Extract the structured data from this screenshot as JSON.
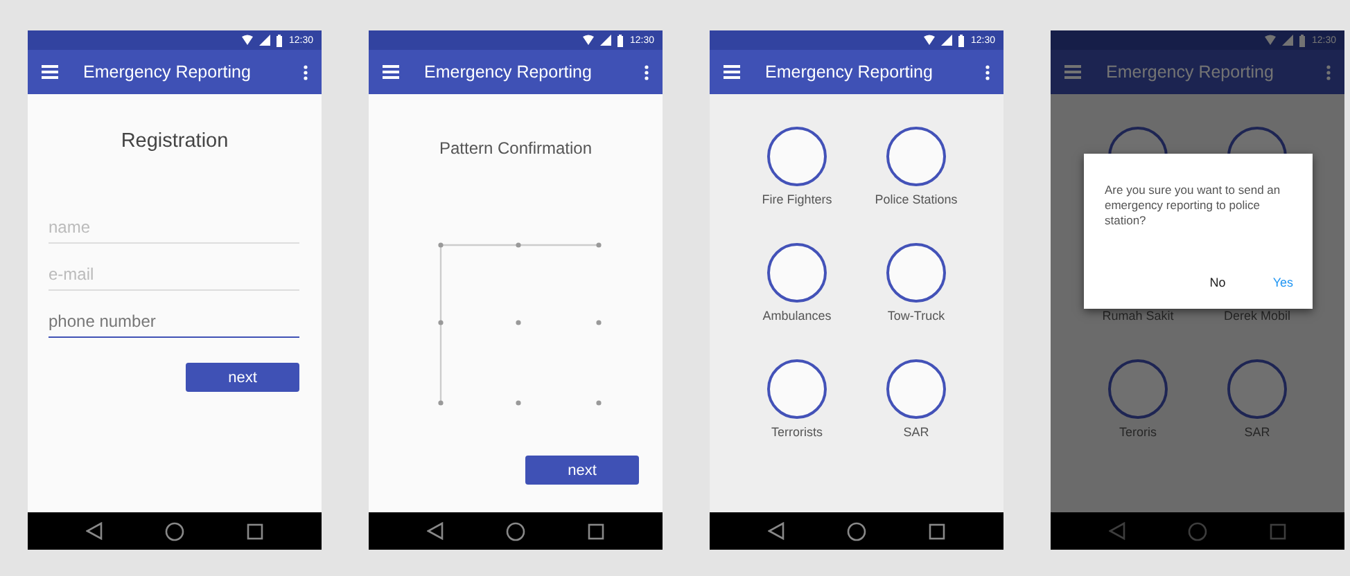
{
  "screens": [
    {
      "kind": "registration",
      "status_time": "12:30",
      "app_title": "Emergency Reporting",
      "heading": "Registration",
      "fields": [
        {
          "placeholder": "name",
          "focused": false
        },
        {
          "placeholder": "e-mail",
          "focused": false
        },
        {
          "placeholder": "phone number",
          "focused": true
        }
      ],
      "button": "next"
    },
    {
      "kind": "pattern",
      "status_time": "12:30",
      "app_title": "Emergency Reporting",
      "heading": "Pattern Confirmation",
      "button": "next"
    },
    {
      "kind": "menu",
      "status_time": "12:30",
      "app_title": "Emergency Reporting",
      "items": [
        {
          "label": "Fire Fighters"
        },
        {
          "label": "Police Stations"
        },
        {
          "label": "Ambulances"
        },
        {
          "label": "Tow-Truck"
        },
        {
          "label": "Terrorists"
        },
        {
          "label": "SAR"
        }
      ]
    },
    {
      "kind": "menu",
      "status_time": "12:30",
      "app_title": "Emergency Reporting",
      "items": [
        {
          "kind": "covered"
        },
        {
          "kind": "covered"
        },
        {
          "kind": "labeled",
          "label": "Rumah Sakit"
        },
        {
          "kind": "labeled",
          "label": "Derek Mobil"
        },
        {
          "kind": "labeled",
          "label": "Teroris"
        },
        {
          "kind": "labeled",
          "label": "SAR"
        }
      ],
      "dialog": {
        "message": "Are you sure you want to send an emergency reporting to police station?",
        "buttons": [
          {
            "label": "No",
            "kind": "neutral"
          },
          {
            "label": "Yes",
            "kind": "positive"
          }
        ]
      }
    }
  ]
}
